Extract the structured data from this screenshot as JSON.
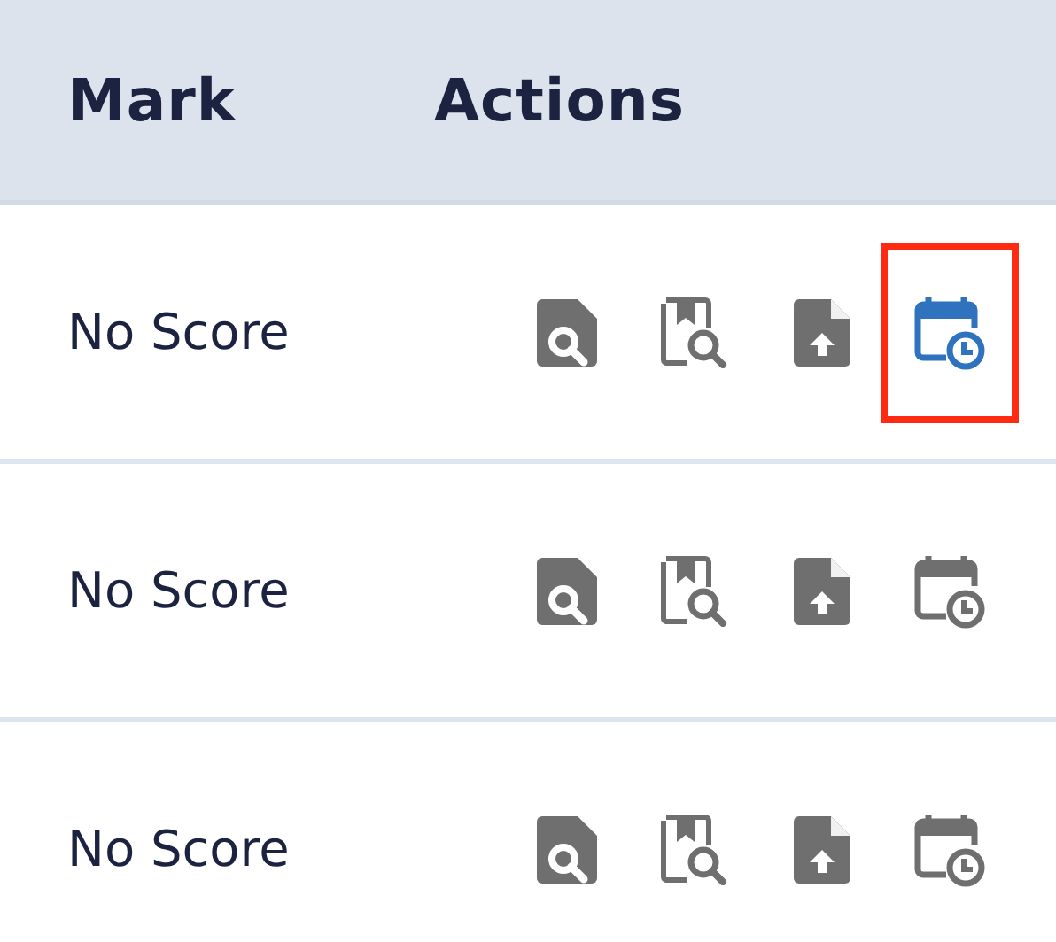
{
  "table": {
    "columns": [
      "Mark",
      "Actions"
    ],
    "rows": [
      {
        "mark": "No Score",
        "schedule_highlighted": true
      },
      {
        "mark": "No Score",
        "schedule_highlighted": false
      },
      {
        "mark": "No Score",
        "schedule_highlighted": false
      }
    ]
  }
}
